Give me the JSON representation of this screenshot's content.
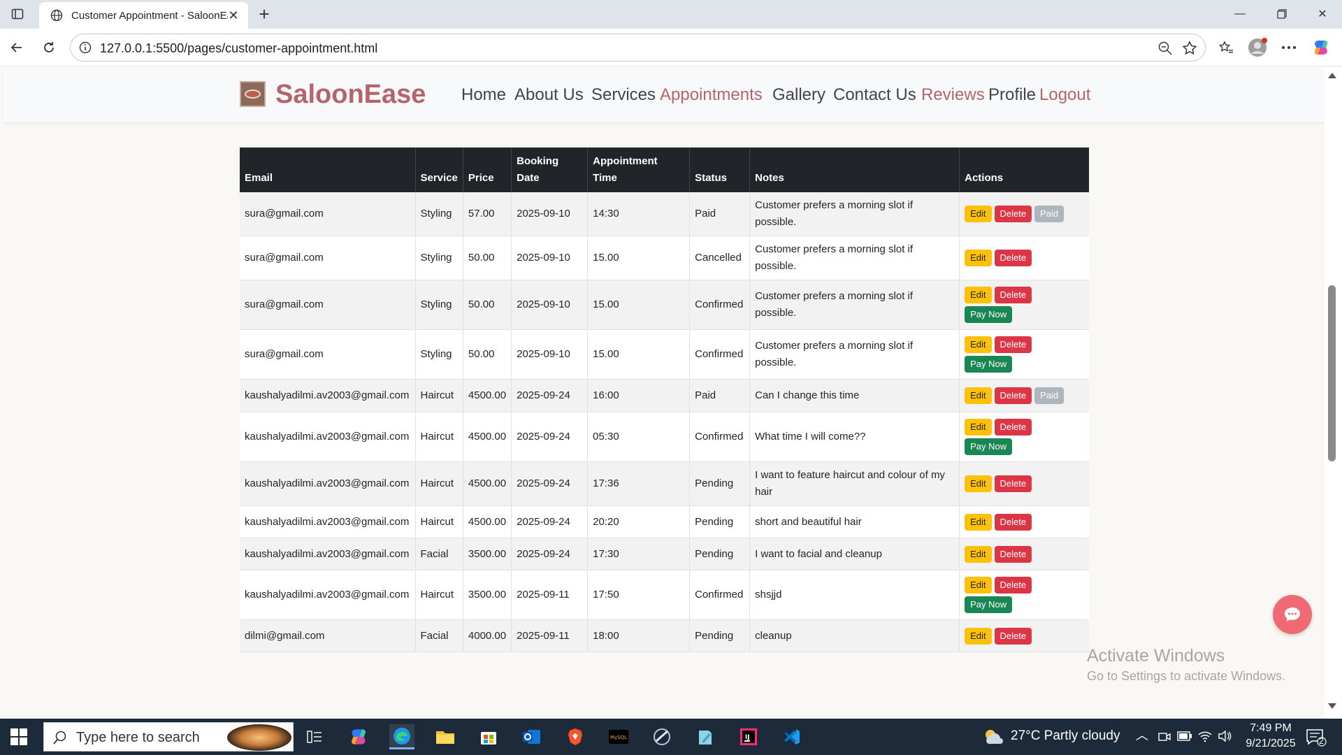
{
  "browser": {
    "tab_title": "Customer Appointment - SaloonEase",
    "url": "127.0.0.1:5500/pages/customer-appointment.html"
  },
  "site": {
    "brand": "SaloonEase",
    "nav": [
      {
        "label": "Home"
      },
      {
        "label": "About Us"
      },
      {
        "label": "Services"
      },
      {
        "label": "Appointments"
      },
      {
        "label": "Gallery"
      },
      {
        "label": "Contact Us"
      },
      {
        "label": "Reviews"
      },
      {
        "label": "Profile"
      },
      {
        "label": "Logout"
      }
    ]
  },
  "table": {
    "headers": [
      "Email",
      "Service",
      "Price",
      "Booking Date",
      "Appointment Time",
      "Status",
      "Notes",
      "Actions"
    ],
    "buttons": {
      "edit": "Edit",
      "delete": "Delete",
      "paid": "Paid",
      "pay": "Pay Now"
    },
    "rows": [
      {
        "email": "sura@gmail.com",
        "service": "Styling",
        "price": "57.00",
        "date": "2025-09-10",
        "time": "14:30",
        "status": "Paid",
        "notes": "Customer prefers a morning slot if possible."
      },
      {
        "email": "sura@gmail.com",
        "service": "Styling",
        "price": "50.00",
        "date": "2025-09-10",
        "time": "15.00",
        "status": "Cancelled",
        "notes": "Customer prefers a morning slot if possible."
      },
      {
        "email": "sura@gmail.com",
        "service": "Styling",
        "price": "50.00",
        "date": "2025-09-10",
        "time": "15.00",
        "status": "Confirmed",
        "notes": "Customer prefers a morning slot if possible."
      },
      {
        "email": "sura@gmail.com",
        "service": "Styling",
        "price": "50.00",
        "date": "2025-09-10",
        "time": "15.00",
        "status": "Confirmed",
        "notes": "Customer prefers a morning slot if possible."
      },
      {
        "email": "kaushalyadilmi.av2003@gmail.com",
        "service": "Haircut",
        "price": "4500.00",
        "date": "2025-09-24",
        "time": "16:00",
        "status": "Paid",
        "notes": "Can I change this time"
      },
      {
        "email": "kaushalyadilmi.av2003@gmail.com",
        "service": "Haircut",
        "price": "4500.00",
        "date": "2025-09-24",
        "time": "05:30",
        "status": "Confirmed",
        "notes": "What time I will come??"
      },
      {
        "email": "kaushalyadilmi.av2003@gmail.com",
        "service": "Haircut",
        "price": "4500.00",
        "date": "2025-09-24",
        "time": "17:36",
        "status": "Pending",
        "notes": "I want to feature haircut and colour of my hair"
      },
      {
        "email": "kaushalyadilmi.av2003@gmail.com",
        "service": "Haircut",
        "price": "4500.00",
        "date": "2025-09-24",
        "time": "20:20",
        "status": "Pending",
        "notes": "short and beautiful hair"
      },
      {
        "email": "kaushalyadilmi.av2003@gmail.com",
        "service": "Facial",
        "price": "3500.00",
        "date": "2025-09-24",
        "time": "17:30",
        "status": "Pending",
        "notes": "I want to facial and cleanup"
      },
      {
        "email": "kaushalyadilmi.av2003@gmail.com",
        "service": "Haircut",
        "price": "3500.00",
        "date": "2025-09-11",
        "time": "17:50",
        "status": "Confirmed",
        "notes": "shsjjd"
      },
      {
        "email": "dilmi@gmail.com",
        "service": "Facial",
        "price": "4000.00",
        "date": "2025-09-11",
        "time": "18:00",
        "status": "Pending",
        "notes": "cleanup"
      }
    ]
  },
  "watermark": {
    "line1": "Activate Windows",
    "line2": "Go to Settings to activate Windows."
  },
  "taskbar": {
    "search_placeholder": "Type here to search",
    "weather": "27°C  Partly cloudy",
    "time": "7:49 PM",
    "date": "9/21/2025",
    "notifications": "2"
  }
}
